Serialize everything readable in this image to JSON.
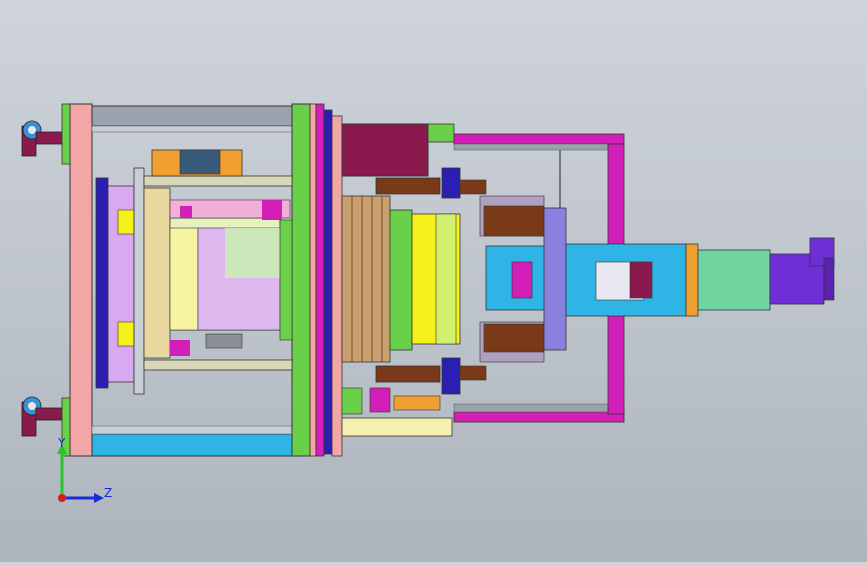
{
  "viewport": {
    "background_top": "#cfd4db",
    "background_bottom": "#aeb4bd"
  },
  "model": {
    "frame_color": "#f2a6a6",
    "rail_color": "#9aa3ad",
    "accent_colors": {
      "green": "#6ad04a",
      "magenta": "#d21fb8",
      "yellow": "#f4f21a",
      "blue": "#2a1fb0",
      "cyan": "#2fb4e6",
      "purple": "#6e2fd6",
      "maroon": "#8a1a4e",
      "mint": "#6fd4a0",
      "brown": "#7a3a1a"
    }
  },
  "triad": {
    "y_label": "Y",
    "z_label": "Z",
    "x_color": "#d81b1b",
    "y_color": "#2cc22c",
    "z_color": "#1a2bd6"
  }
}
